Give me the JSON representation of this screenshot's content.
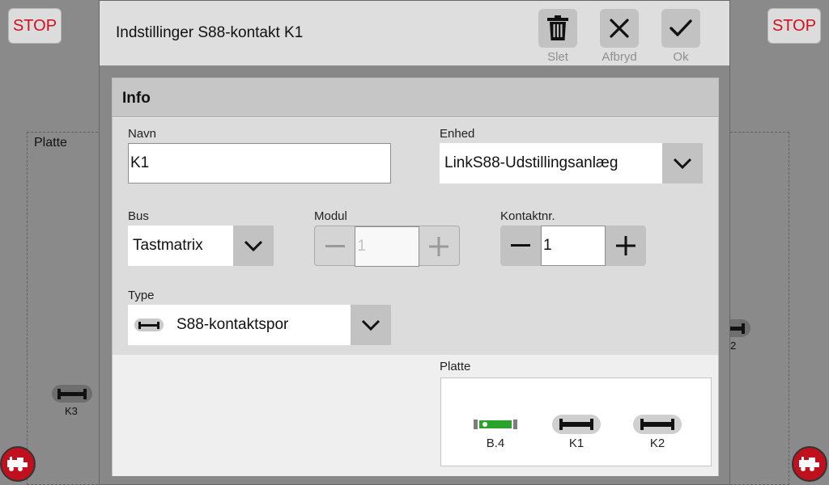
{
  "background": {
    "stop_left": "STOP",
    "stop_right": "STOP",
    "panel_title": "Platte",
    "track_labels": {
      "k3": "K3",
      "k2_partial": "2"
    }
  },
  "dialog": {
    "title": "Indstillinger S88-kontakt K1",
    "actions": {
      "delete_label": "Slet",
      "cancel_label": "Afbryd",
      "ok_label": "Ok"
    },
    "section_title": "Info",
    "fields": {
      "name_label": "Navn",
      "name_value": "K1",
      "device_label": "Enhed",
      "device_value": "LinkS88-Udstillingsanlæg",
      "bus_label": "Bus",
      "bus_value": "Tastmatrix",
      "module_label": "Modul",
      "module_value": "1",
      "contact_label": "Kontaktnr.",
      "contact_value": "1",
      "type_label": "Type",
      "type_value": "S88-kontaktspor"
    },
    "preview": {
      "label": "Platte",
      "items": [
        {
          "label": "B.4",
          "icon": "block-section-icon",
          "occupied_color": "#29a329"
        },
        {
          "label": "K1",
          "icon": "track-contact-icon"
        },
        {
          "label": "K2",
          "icon": "track-contact-icon"
        }
      ]
    }
  },
  "colors": {
    "stop_text": "#d0101d",
    "loco_button": "#c0101d",
    "occupied": "#29a329"
  }
}
